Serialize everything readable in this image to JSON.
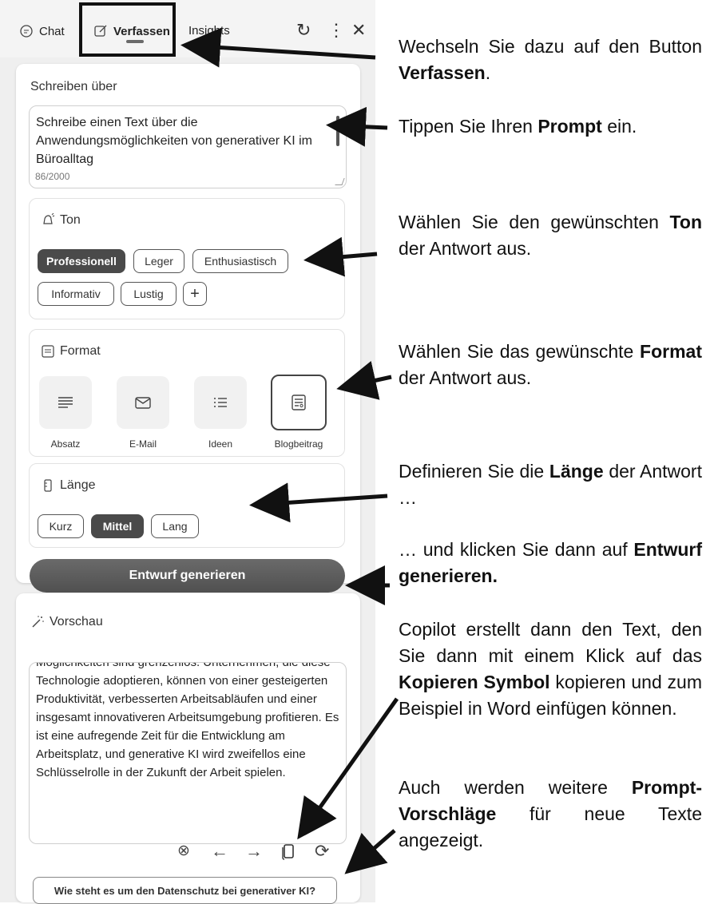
{
  "tabs": {
    "chat": "Chat",
    "compose": "Verfassen",
    "insights": "Insights"
  },
  "icons": {
    "refresh": "refresh-icon",
    "more": "more-icon",
    "close": "close-icon"
  },
  "write_about": {
    "label": "Schreiben über",
    "value": "Schreibe einen Text über die Anwendungsmöglichkeiten von generativer KI im Büroalltag",
    "count": "86/2000"
  },
  "tone": {
    "label": "Ton",
    "options": [
      "Professionell",
      "Leger",
      "Enthusiastisch",
      "Informativ",
      "Lustig",
      "+"
    ],
    "selected": "Professionell"
  },
  "format": {
    "label": "Format",
    "options": [
      "Absatz",
      "E-Mail",
      "Ideen",
      "Blogbeitrag"
    ],
    "selected": "Blogbeitrag"
  },
  "length": {
    "label": "Länge",
    "options": [
      "Kurz",
      "Mittel",
      "Lang"
    ],
    "selected": "Mittel"
  },
  "generate_button": "Entwurf generieren",
  "preview": {
    "label": "Vorschau",
    "text": "Möglichkeiten sind grenzenlos. Unternehmen, die diese Technologie adoptieren, können von einer gesteigerten Produktivität, verbesserten Arbeitsabläufen und einer insgesamt innovativeren Arbeitsumgebung profitieren. Es ist eine aufregende Zeit für die Entwicklung am Arbeitsplatz, und generative KI wird zweifellos eine Schlüsselrolle in der Zukunft der Arbeit spielen."
  },
  "suggestion": "Wie steht es um den Datenschutz bei generativer KI?",
  "instructions": {
    "i1": {
      "pre": "Wechseln Sie dazu auf den Button ",
      "bold": "Verfassen",
      "post": "."
    },
    "i2": {
      "pre": "Tippen Sie Ihren ",
      "bold": "Prompt",
      "post": " ein."
    },
    "i3": {
      "pre": "Wählen Sie den gewünschten ",
      "bold": "Ton",
      "post": " der Antwort aus."
    },
    "i4": {
      "pre": "Wählen Sie das gewünschte ",
      "bold": "Format",
      "post": " der Antwort aus."
    },
    "i5": {
      "pre": "Definieren Sie die ",
      "bold": "Länge",
      "post": " der Antwort …"
    },
    "i6": {
      "pre": "… und klicken Sie dann auf ",
      "bold": "Entwurf generieren.",
      "post": ""
    },
    "i7": {
      "pre": "Copilot erstellt dann den Text, den Sie dann mit einem Klick auf das ",
      "bold": "Kopieren Symbol",
      "post": " kopieren und zum Beispiel in Word einfügen können."
    },
    "i8": {
      "pre": "Auch werden weitere ",
      "bold": "Prompt-Vorschläge",
      "post": " für neue Texte angezeigt."
    }
  }
}
